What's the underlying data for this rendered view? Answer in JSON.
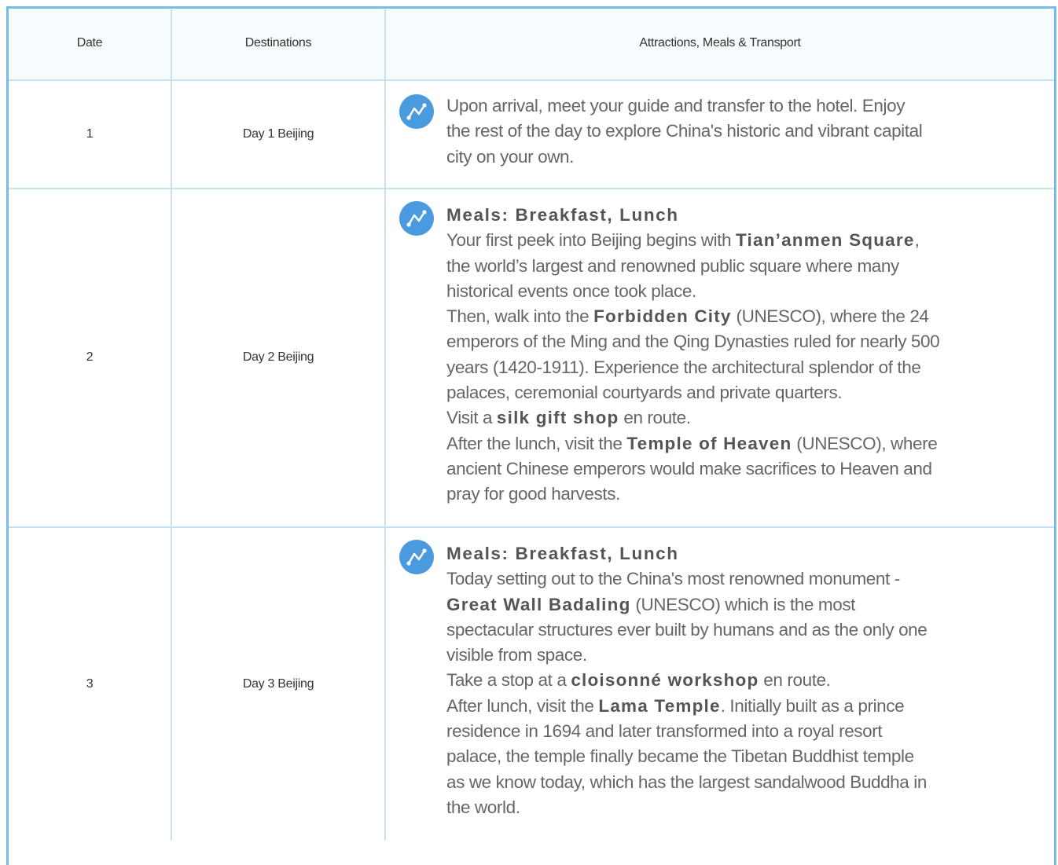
{
  "table": {
    "headers": {
      "date": "Date",
      "destinations": "Destinations",
      "attractions": "Attractions, Meals & Transport"
    },
    "rows": [
      {
        "date": "1",
        "destination": "Day 1 Beijing",
        "icon": "route-icon",
        "lines": [
          "Upon arrival, meet your guide and transfer to the hotel. Enjoy",
          "the rest of the day to explore China's historic and vibrant capital",
          "city on your own."
        ]
      },
      {
        "date": "2",
        "destination": "Day 2 Beijing",
        "icon": "route-icon",
        "meals": "Meals: Breakfast, Lunch",
        "p1_a": "Your first peek into Beijing begins with ",
        "p1_b": "Tian’anmen Square",
        "p1_c": ",",
        "p1_l2": "the world’s largest and renowned public square where many",
        "p1_l3": "historical events once took place.",
        "p2_a": "Then, walk into the ",
        "p2_b": "Forbidden City",
        "p2_c": " (UNESCO), where the 24",
        "p2_l2": "emperors of the Ming and the Qing Dynasties ruled for nearly 500",
        "p2_l3": "years (1420-1911). Experience the architectural splendor of the",
        "p2_l4": "palaces, ceremonial courtyards and private quarters.",
        "p3_a": "Visit a ",
        "p3_b": "silk gift shop",
        "p3_c": " en route.",
        "p4_a": "After the lunch, visit the ",
        "p4_b": "Temple of Heaven",
        "p4_c": " (UNESCO), where",
        "p4_l2": "ancient Chinese emperors would make sacrifices to Heaven and",
        "p4_l3": "pray for good harvests."
      },
      {
        "date": "3",
        "destination": "Day 3 Beijing",
        "icon": "route-icon",
        "meals": "Meals: Breakfast, Lunch",
        "p1_l1": "Today setting out to the China's most renowned monument -",
        "p1_b": "Great Wall Badaling",
        "p1_c": " (UNESCO) which is the most",
        "p1_l3": "spectacular structures ever built by humans and as the only one",
        "p1_l4": "visible from space.",
        "p2_a": "Take a stop at a ",
        "p2_b": "cloisonné workshop",
        "p2_c": " en route.",
        "p3_a": "After lunch, visit the ",
        "p3_b": "Lama Temple",
        "p3_c": ". Initially built as a prince",
        "p3_l2": "residence in 1694 and later transformed into a royal resort",
        "p3_l3": "palace, the temple finally became the Tibetan Buddhist temple",
        "p3_l4": "as we know today, which has the largest sandalwood Buddha in",
        "p3_l5": "the world."
      }
    ]
  },
  "colors": {
    "frame": "#77bbe8",
    "grid": "#c5e3f6",
    "icon": "#4a9ae0"
  }
}
